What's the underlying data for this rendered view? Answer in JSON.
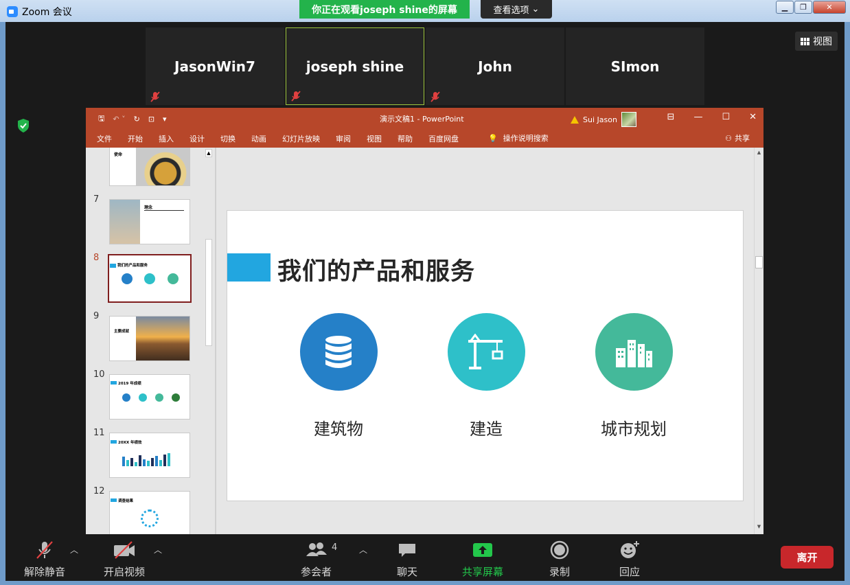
{
  "window": {
    "title": "Zoom 会议"
  },
  "banner": {
    "sharing_text": "你正在观看joseph  shine的屏幕",
    "view_options_label": "查看选项"
  },
  "participants_tiles": [
    {
      "name": "JasonWin7",
      "muted": true
    },
    {
      "name": "joseph shine",
      "muted": true,
      "active_speaker": true
    },
    {
      "name": "John",
      "muted": true
    },
    {
      "name": "SImon",
      "muted": false
    }
  ],
  "view_button": {
    "label": "视图"
  },
  "powerpoint": {
    "doc_title": "演示文稿1  -  PowerPoint",
    "user_name": "Sui Jason",
    "ribbon_tabs": [
      "文件",
      "开始",
      "插入",
      "设计",
      "切换",
      "动画",
      "幻灯片放映",
      "审阅",
      "视图",
      "帮助",
      "百度网盘"
    ],
    "tell_me": "操作说明搜索",
    "share_label": "共享",
    "thumbnails": [
      {
        "number": "",
        "title": "使命"
      },
      {
        "number": "7",
        "title": "理念"
      },
      {
        "number": "8",
        "title": "我们的产品和服务"
      },
      {
        "number": "9",
        "title": "主要成就"
      },
      {
        "number": "10",
        "title": "2019 年成绩"
      },
      {
        "number": "11",
        "title": "20XX 年绩效"
      },
      {
        "number": "12",
        "title": "调查结果"
      }
    ],
    "slide": {
      "title": "我们的产品和服务",
      "services": [
        {
          "label": "建筑物",
          "icon": "database-icon",
          "color": "#2580c8"
        },
        {
          "label": "建造",
          "icon": "crane-icon",
          "color": "#2ec0c9"
        },
        {
          "label": "城市规划",
          "icon": "city-icon",
          "color": "#44b99a"
        }
      ]
    }
  },
  "toolbar": {
    "unmute": "解除静音",
    "start_video": "开启视频",
    "participants": "参会者",
    "participants_count": "4",
    "chat": "聊天",
    "share_screen": "共享屏幕",
    "record": "录制",
    "reactions": "回应",
    "leave": "离开"
  },
  "colors": {
    "accent_green": "#23b34b",
    "ppt_red": "#b7472a",
    "leave_red": "#c8272b",
    "title_bar_blue": "#22a6e0"
  }
}
